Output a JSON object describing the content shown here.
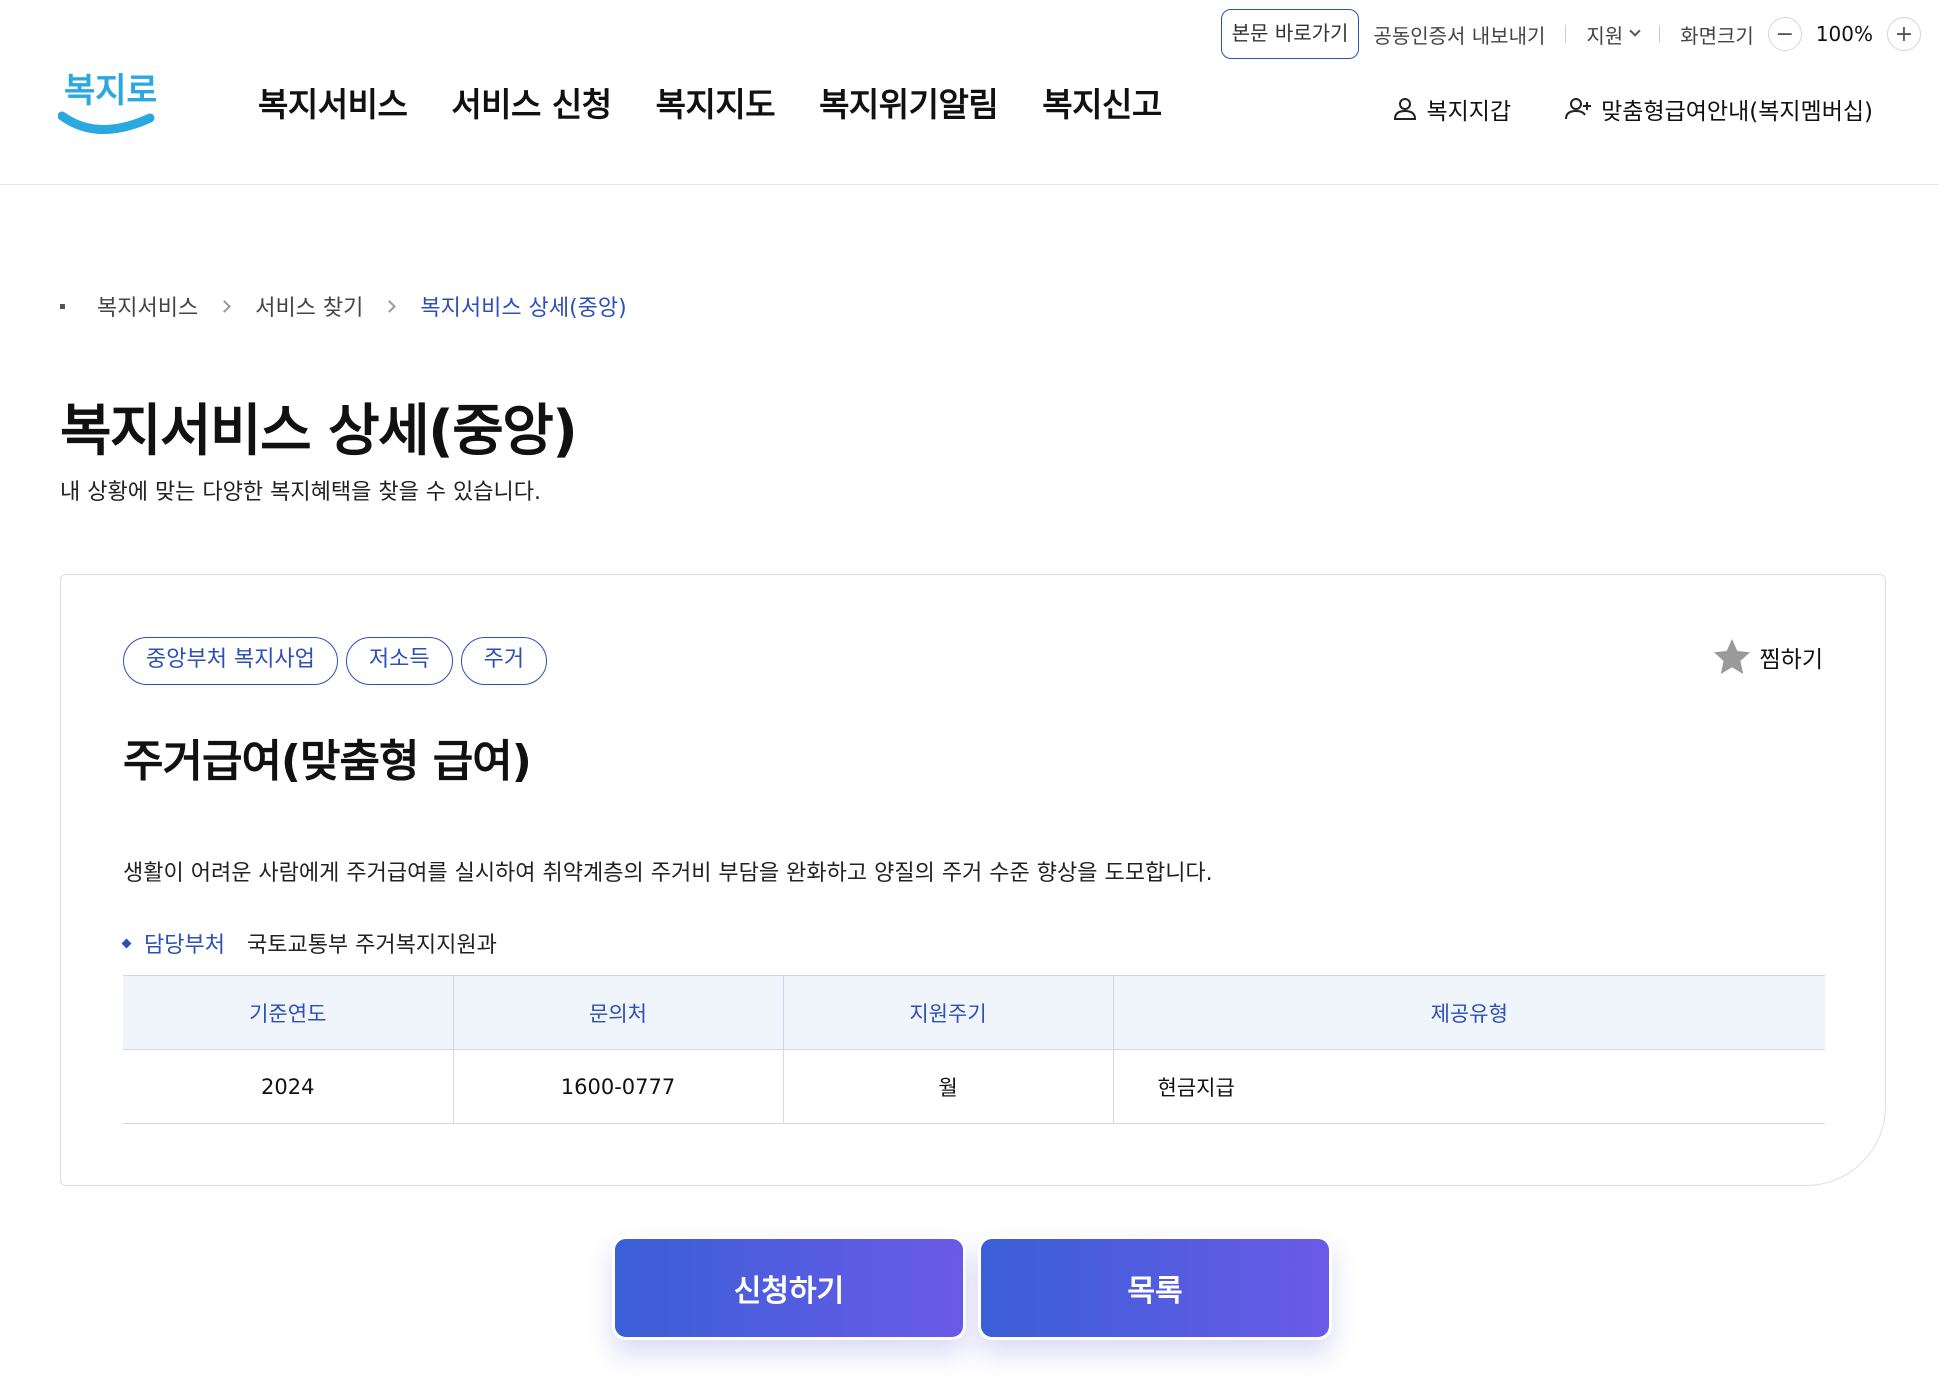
{
  "utility": {
    "skip_link": "본문 바로가기",
    "cert_export": "공동인증서 내보내기",
    "support": "지원",
    "screen_size": "화면크기",
    "zoom": "100%",
    "zoom_out": "−",
    "zoom_in": "+"
  },
  "header": {
    "logo_text": "복지로",
    "nav": [
      "복지서비스",
      "서비스 신청",
      "복지지도",
      "복지위기알림",
      "복지신고"
    ],
    "wallet": "복지지갑",
    "membership": "맞춤형급여안내(복지멤버십)"
  },
  "breadcrumb": [
    "복지서비스",
    "서비스 찾기",
    "복지서비스 상세(중앙)"
  ],
  "page": {
    "title": "복지서비스 상세(중앙)",
    "description": "내 상황에 맞는 다양한 복지혜택을 찾을 수 있습니다."
  },
  "service": {
    "tags": [
      "중앙부처 복지사업",
      "저소득",
      "주거"
    ],
    "favorite": "찜하기",
    "title": "주거급여(맞춤형 급여)",
    "description": "생활이 어려운 사람에게 주거급여를 실시하여 취약계층의 주거비 부담을 완화하고 양질의 주거 수준 향상을 도모합니다.",
    "dept_label": "담당부처",
    "dept_value": "국토교통부 주거복지지원과",
    "table": {
      "headers": [
        "기준연도",
        "문의처",
        "지원주기",
        "제공유형"
      ],
      "row": [
        "2024",
        "1600-0777",
        "월",
        "현금지급"
      ]
    }
  },
  "actions": {
    "apply": "신청하기",
    "list": "목록"
  },
  "colors": {
    "brand_blue": "#2c4fb8",
    "button_start": "#3a5fd6",
    "button_end": "#6a5ae8",
    "logo_sky": "#2aa8e0"
  }
}
